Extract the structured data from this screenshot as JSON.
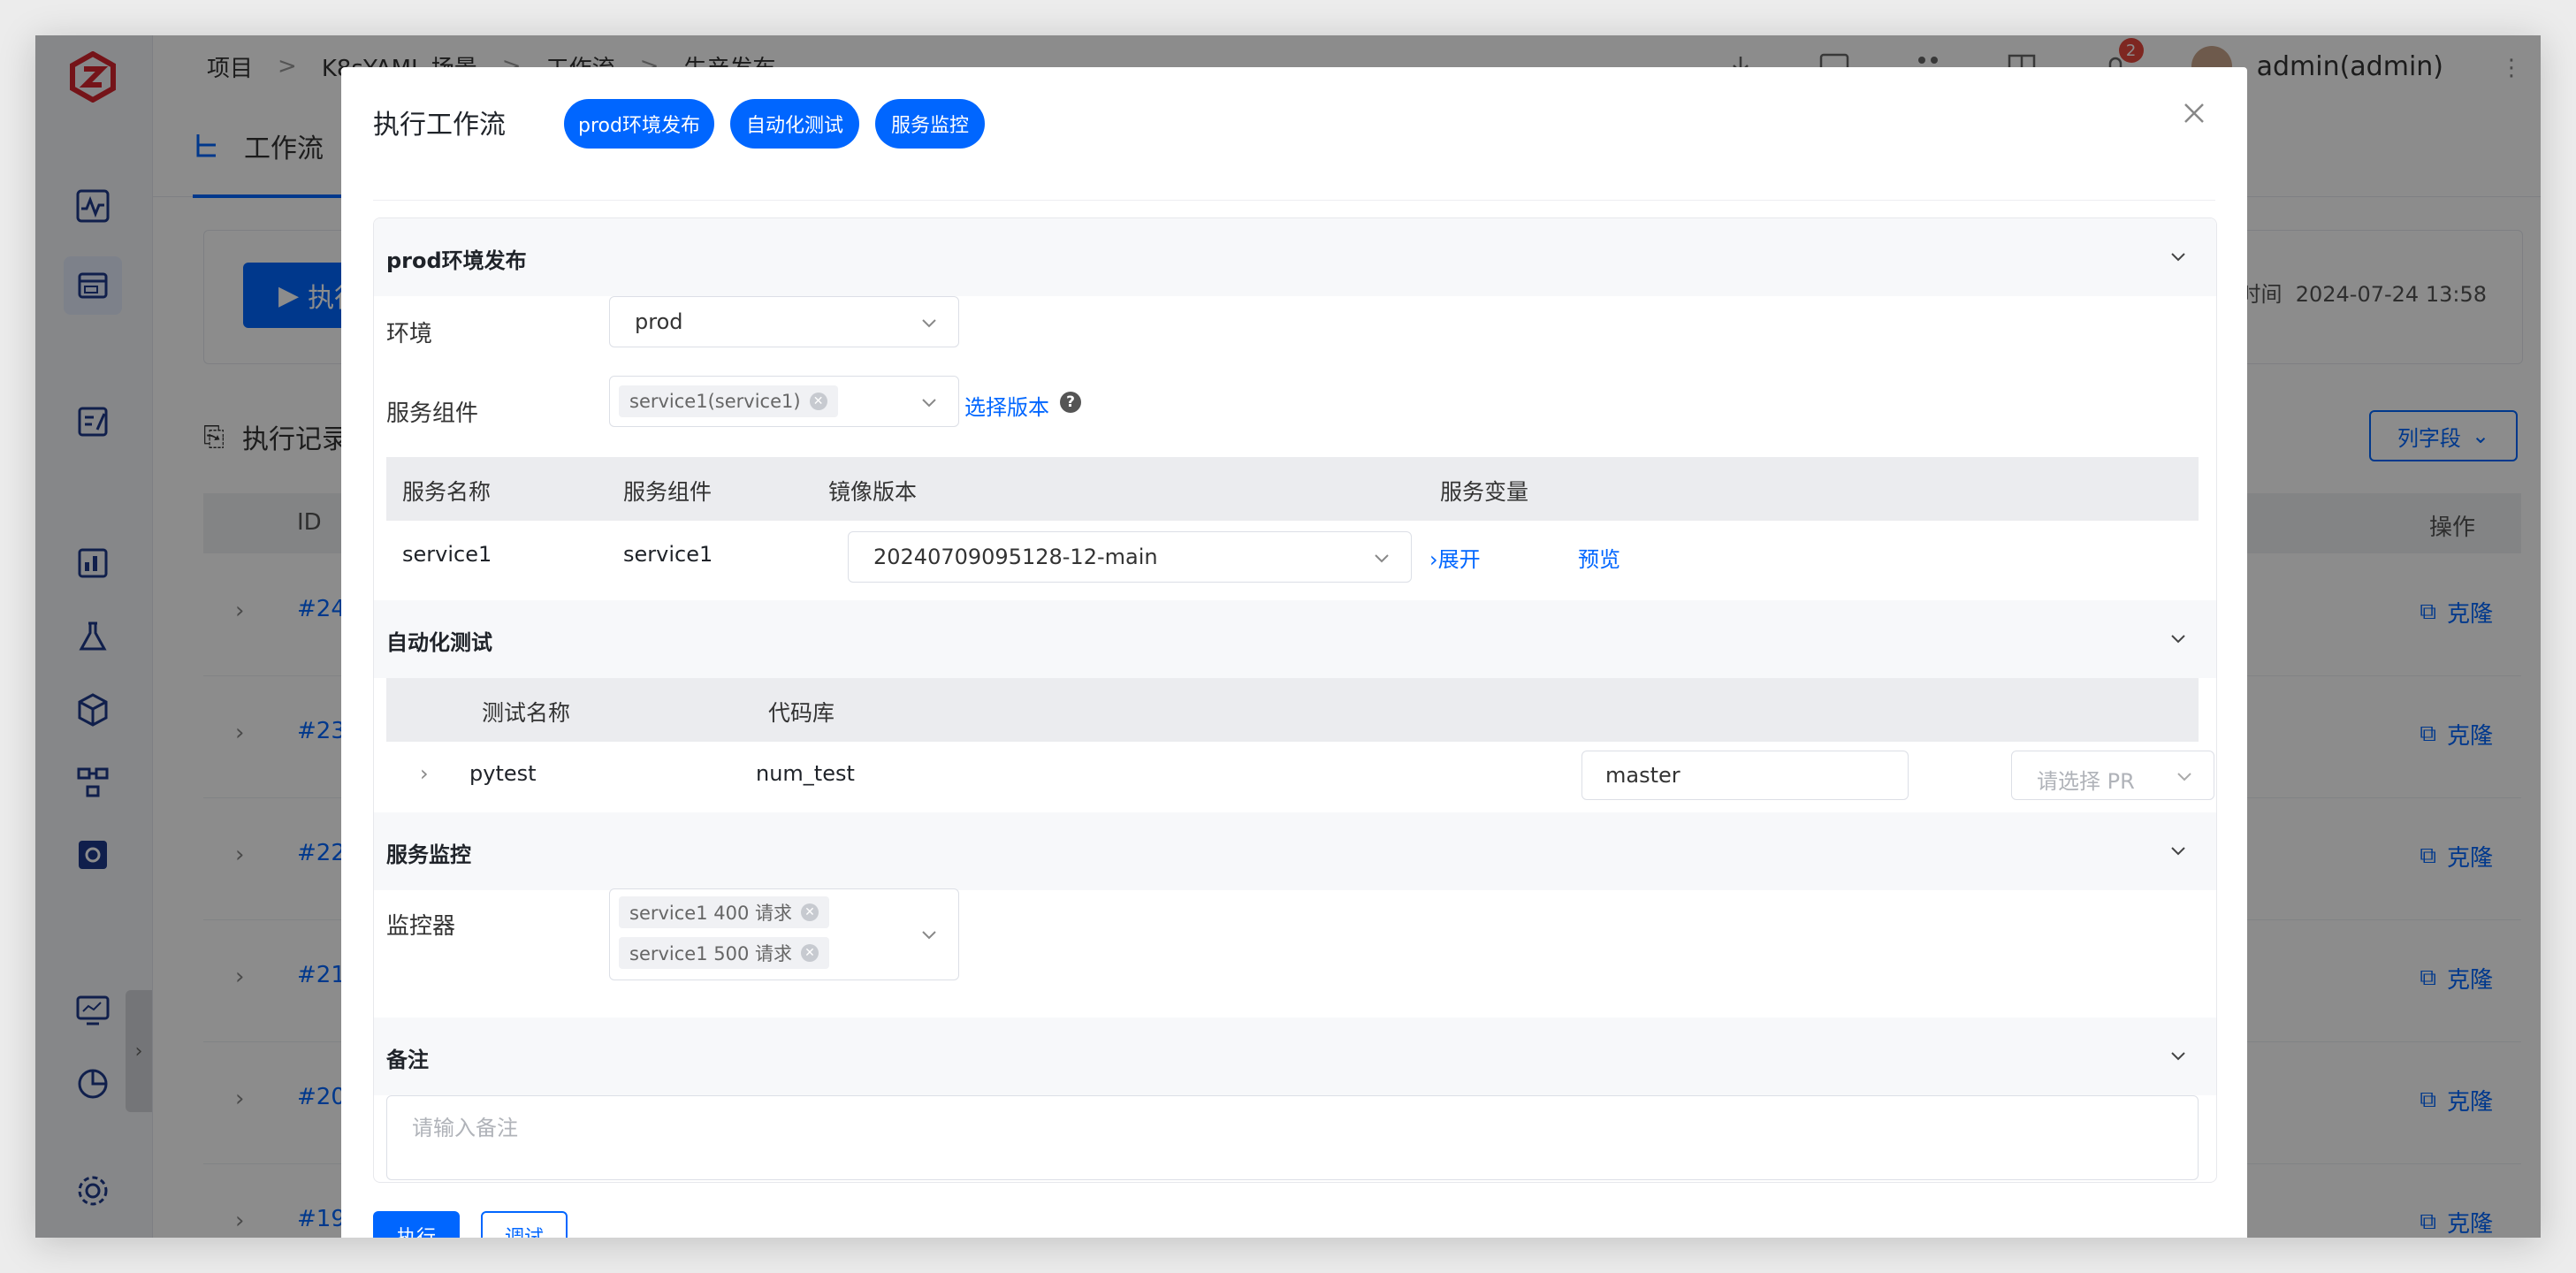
{
  "app": {
    "breadcrumb": [
      "项目",
      "K8sYAML 场景",
      "工作流",
      "生产发布"
    ],
    "user_name": "admin(admin)",
    "notification_count": "2",
    "page_tab": "工作流",
    "run_button": "执行",
    "update_time_label": "改时间",
    "update_time": "2024-07-24 13:58",
    "records_title": "执行记录",
    "column_button": "列字段",
    "table_headers": {
      "id": "ID",
      "op": "操作"
    },
    "rows": [
      {
        "id": "#24",
        "op": "克隆"
      },
      {
        "id": "#23",
        "op": "克隆"
      },
      {
        "id": "#22",
        "op": "克隆"
      },
      {
        "id": "#21",
        "op": "克隆"
      },
      {
        "id": "#20",
        "op": "克隆"
      },
      {
        "id": "#19",
        "op": "克隆"
      }
    ]
  },
  "modal": {
    "title": "执行工作流",
    "pills": [
      "prod环境发布",
      "自动化测试",
      "服务监控"
    ],
    "deploy": {
      "title": "prod环境发布",
      "env_label": "环境",
      "env_value": "prod",
      "component_label": "服务组件",
      "component_tag": "service1(service1)",
      "select_version": "选择版本",
      "table_headers": [
        "服务名称",
        "服务组件",
        "镜像版本",
        "服务变量"
      ],
      "row": {
        "service_name": "service1",
        "component": "service1",
        "image_version": "20240709095128-12-main",
        "expand": "展开",
        "preview": "预览"
      }
    },
    "autotest": {
      "title": "自动化测试",
      "table_headers": [
        "测试名称",
        "代码库"
      ],
      "row": {
        "name": "pytest",
        "repo": "num_test",
        "branch": "master",
        "pr_placeholder": "请选择 PR"
      }
    },
    "monitor": {
      "title": "服务监控",
      "label": "监控器",
      "tags": [
        "service1 400 请求",
        "service1 500 请求"
      ]
    },
    "remark": {
      "title": "备注",
      "placeholder": "请输入备注"
    },
    "buttons": {
      "run": "执行",
      "debug": "调试"
    }
  }
}
